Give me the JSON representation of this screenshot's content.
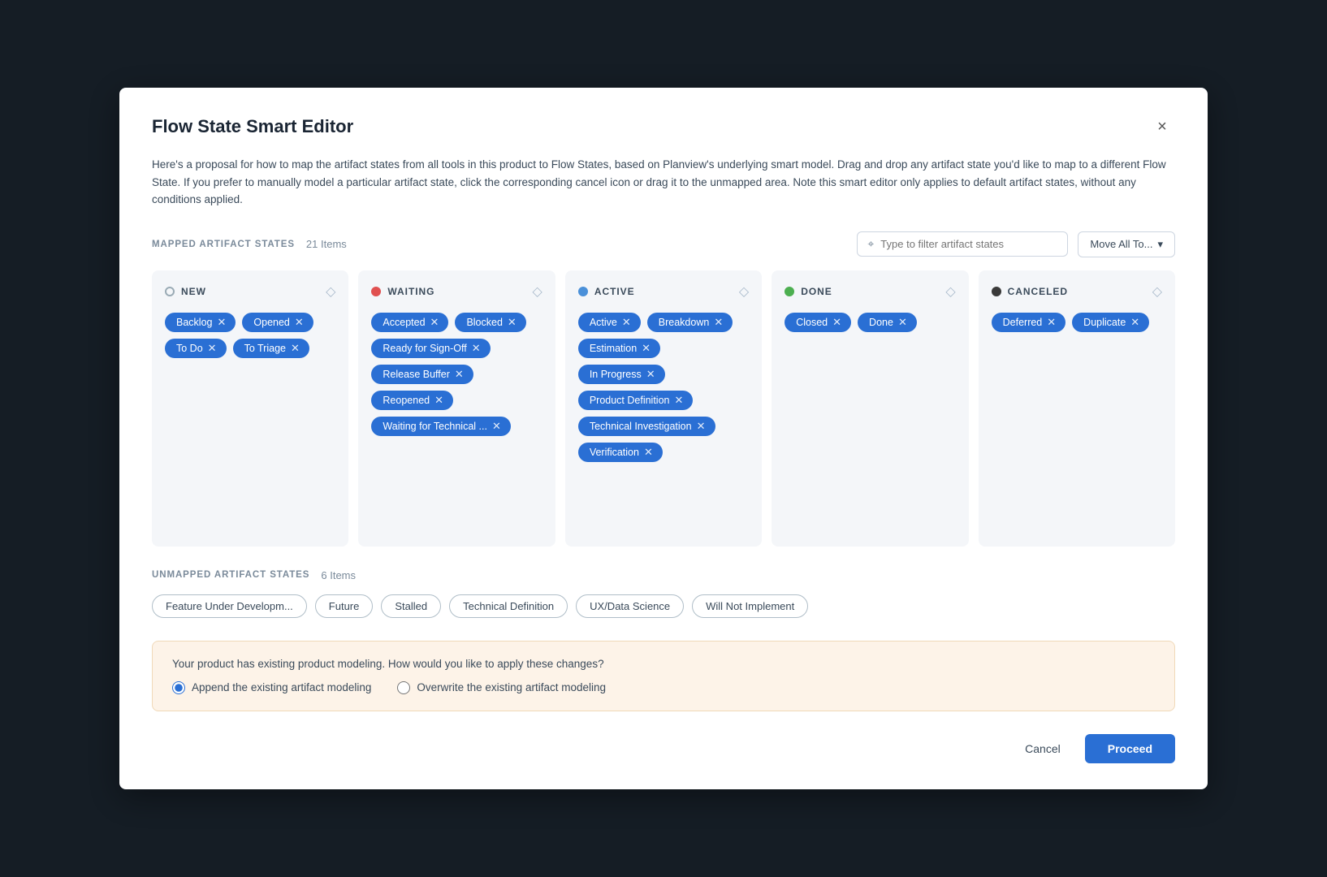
{
  "modal": {
    "title": "Flow State Smart Editor",
    "close_label": "×",
    "description": "Here's a proposal for how to map the artifact states from all tools in this product to Flow States, based on Planview's underlying smart model. Drag and drop any artifact state you'd like to map to a different Flow State. If you prefer to manually model a particular artifact state, click the corresponding cancel icon or drag it to the unmapped area. Note this smart editor only applies to default artifact states, without any conditions applied."
  },
  "mapped_section": {
    "label": "MAPPED ARTIFACT STATES",
    "count": "21 Items",
    "filter_placeholder": "Type to filter artifact states",
    "move_all_label": "Move All To...",
    "move_all_dropdown": "▾"
  },
  "columns": [
    {
      "id": "new",
      "dot_class": "dot-new",
      "title": "NEW",
      "tags": [
        "Backlog",
        "Opened",
        "To Do",
        "To Triage"
      ]
    },
    {
      "id": "waiting",
      "dot_class": "dot-waiting",
      "title": "WAITING",
      "tags": [
        "Accepted",
        "Blocked",
        "Ready for Sign-Off",
        "Release Buffer",
        "Reopened",
        "Waiting for Technical ..."
      ]
    },
    {
      "id": "active",
      "dot_class": "dot-active",
      "title": "ACTIVE",
      "tags": [
        "Active",
        "Breakdown",
        "Estimation",
        "In Progress",
        "Product Definition",
        "Technical Investigation",
        "Verification"
      ]
    },
    {
      "id": "done",
      "dot_class": "dot-done",
      "title": "DONE",
      "tags": [
        "Closed",
        "Done"
      ]
    },
    {
      "id": "canceled",
      "dot_class": "dot-canceled",
      "title": "CANCELED",
      "tags": [
        "Deferred",
        "Duplicate"
      ]
    }
  ],
  "unmapped_section": {
    "label": "UNMAPPED ARTIFACT STATES",
    "count": "6 Items",
    "tags": [
      "Feature Under Developm...",
      "Future",
      "Stalled",
      "Technical Definition",
      "UX/Data Science",
      "Will Not Implement"
    ]
  },
  "notice": {
    "text": "Your product has existing product modeling. How would you like to apply these changes?",
    "options": [
      {
        "id": "append",
        "label": "Append the existing artifact modeling",
        "checked": true
      },
      {
        "id": "overwrite",
        "label": "Overwrite the existing artifact modeling",
        "checked": false
      }
    ]
  },
  "footer": {
    "cancel_label": "Cancel",
    "proceed_label": "Proceed"
  }
}
